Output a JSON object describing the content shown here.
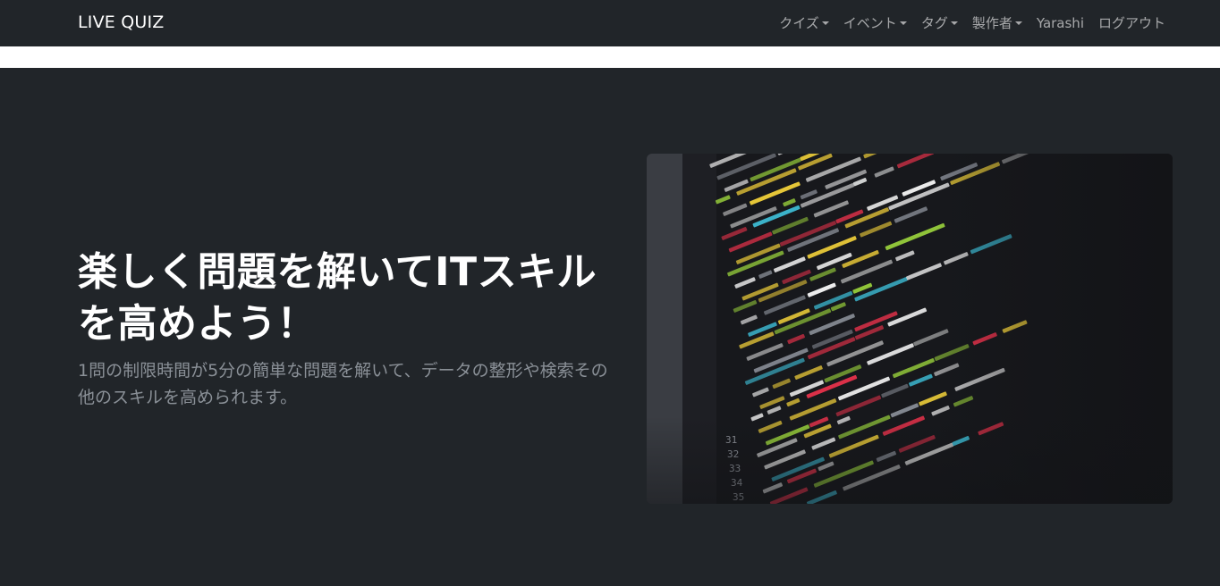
{
  "navbar": {
    "brand": "LIVE QUIZ",
    "items": [
      {
        "label": "クイズ",
        "dropdown": true
      },
      {
        "label": "イベント",
        "dropdown": true
      },
      {
        "label": "タグ",
        "dropdown": true
      },
      {
        "label": "製作者",
        "dropdown": true
      },
      {
        "label": "Yarashi",
        "dropdown": false
      },
      {
        "label": "ログアウト",
        "dropdown": false
      }
    ]
  },
  "hero": {
    "headline": "楽しく問題を解いてITスキルを高めよう！",
    "lead": "1問の制限時間が5分の簡単な問題を解いて、データの整形や検索その他のスキルを高められます。",
    "image": {
      "description_icon": "code-screenshot-image",
      "line_numbers": [
        "31",
        "32",
        "33",
        "34",
        "35"
      ]
    }
  },
  "colors": {
    "navbar_bg": "#212529",
    "hero_bg": "#212529",
    "brand_text": "#ffffff",
    "nav_text": "rgba(255,255,255,0.6)",
    "lead_text": "#8a9097"
  }
}
